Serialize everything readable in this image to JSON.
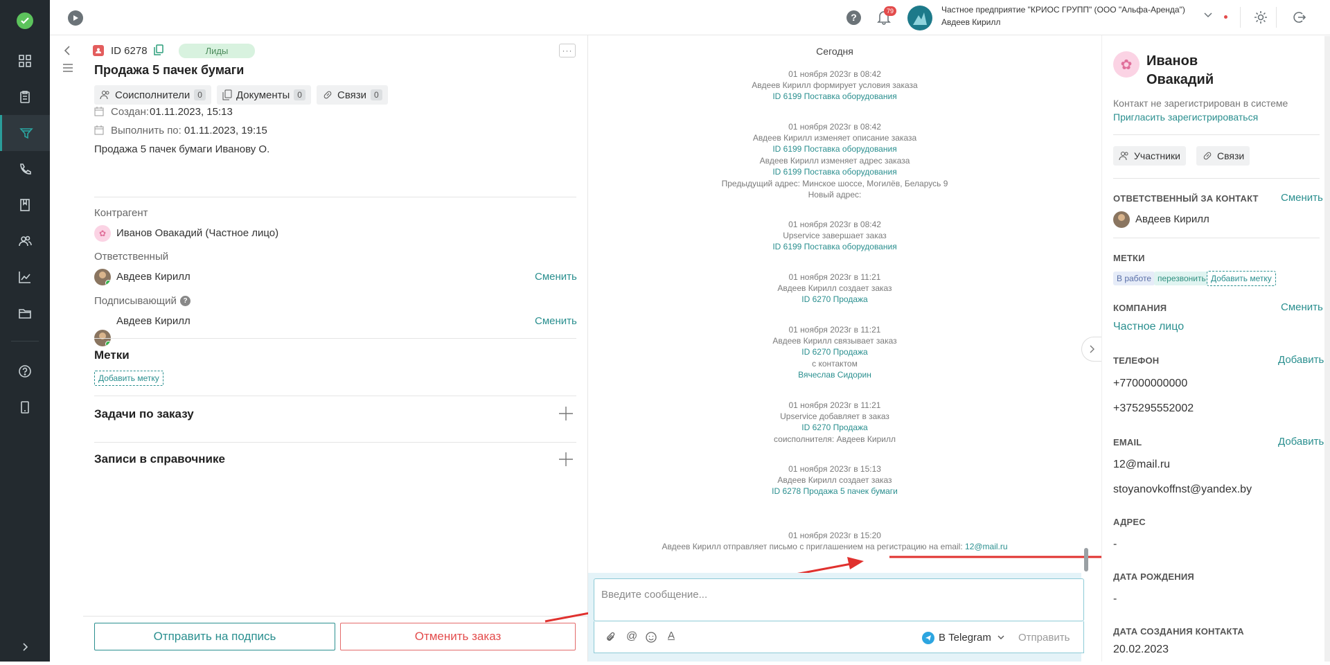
{
  "nav": {
    "items": [
      "dashboard-icon",
      "orders-icon",
      "funnel-icon",
      "calls-icon",
      "book-icon",
      "contacts-icon",
      "analytics-icon",
      "folder-icon",
      "help-icon",
      "mobile-icon"
    ]
  },
  "topbar": {
    "notifications_count": "79",
    "company": "Частное предприятие \"КРИОС ГРУПП\" (ООО \"Альфа-Аренда\")",
    "user": "Авдеев Кирилл"
  },
  "order": {
    "id": "ID 6278",
    "tag": "Лиды",
    "title": "Продажа 5 пачек бумаги",
    "chips": [
      {
        "label": "Соисполнители",
        "count": "0"
      },
      {
        "label": "Документы",
        "count": "0"
      },
      {
        "label": "Связи",
        "count": "0"
      }
    ],
    "created_label": "Создан:",
    "created_value": "01.11.2023, 15:13",
    "due_label": "Выполнить по:",
    "due_value": "01.11.2023, 19:15",
    "description": "Продажа 5 пачек бумаги Иванову О.",
    "counterparty_label": "Контрагент",
    "counterparty_value": "Иванов Овакадий (Частное лицо)",
    "responsible_label": "Ответственный",
    "responsible_value": "Авдеев Кирилл",
    "signer_label": "Подписывающий",
    "signer_value": "Авдеев Кирилл",
    "change": "Сменить",
    "tags_title": "Метки",
    "add_tag": "Добавить метку",
    "tasks_title": "Задачи по заказу",
    "records_title": "Записи в справочнике",
    "send_sign": "Отправить на подпись",
    "cancel_order": "Отменить заказ"
  },
  "feed": {
    "day": "Сегодня",
    "events": [
      {
        "lines": [
          {
            "t": "01 ноября 2023г в 08:42"
          },
          {
            "t": "Авдеев Кирилл формирует условия заказа"
          },
          {
            "t": "ID 6199 Поставка оборудования",
            "link": true
          }
        ]
      },
      {
        "lines": [
          {
            "t": "01 ноября 2023г в 08:42"
          },
          {
            "t": "Авдеев Кирилл изменяет описание заказа"
          },
          {
            "t": "ID 6199 Поставка оборудования",
            "link": true
          },
          {
            "t": "Авдеев Кирилл изменяет адрес заказа"
          },
          {
            "t": "ID 6199 Поставка оборудования",
            "link": true
          },
          {
            "t": "Предыдущий адрес: Минское шоссе, Могилёв, Беларусь 9"
          },
          {
            "t": "Новый адрес:"
          }
        ]
      },
      {
        "lines": [
          {
            "t": "01 ноября 2023г в 08:42"
          },
          {
            "t": "Upservice завершает заказ"
          },
          {
            "t": "ID 6199 Поставка оборудования",
            "link": true
          }
        ]
      },
      {
        "lines": [
          {
            "t": "01 ноября 2023г в 11:21"
          },
          {
            "t": "Авдеев Кирилл создает заказ"
          },
          {
            "t": "ID 6270 Продажа",
            "link": true
          }
        ]
      },
      {
        "lines": [
          {
            "t": "01 ноября 2023г в 11:21"
          },
          {
            "t": "Авдеев Кирилл связывает заказ"
          },
          {
            "t": "ID 6270 Продажа",
            "link": true
          },
          {
            "t": "с контактом"
          },
          {
            "t": "Вячеслав Сидорин",
            "link": true
          }
        ]
      },
      {
        "lines": [
          {
            "t": "01 ноября 2023г в 11:21"
          },
          {
            "t": "Upservice добавляет в заказ"
          },
          {
            "t": "ID 6270 Продажа",
            "link": true
          },
          {
            "t": "соисполнителя: Авдеев Кирилл"
          }
        ]
      },
      {
        "lines": [
          {
            "t": "01 ноября 2023г в 15:13"
          },
          {
            "t": "Авдеев Кирилл создает заказ"
          },
          {
            "t": "ID 6278 Продажа 5 пачек бумаги",
            "link": true
          }
        ]
      }
    ],
    "last_time": "01 ноября 2023г в 15:20",
    "last_text": "Авдеев Кирилл отправляет письмо с приглашением на регистрацию на email:",
    "last_email": "12@mail.ru",
    "composer_placeholder": "Введите сообщение...",
    "channel": "В Telegram",
    "send": "Отправить"
  },
  "contact": {
    "name_line1": "Иванов",
    "name_line2": "Овакадий",
    "not_registered": "Контакт не зарегистрирован в системе",
    "invite": "Пригласить зарегистрироваться",
    "participants": "Участники",
    "links": "Связи",
    "responsible_title": "ОТВЕТСТВЕННЫЙ ЗА КОНТАКТ",
    "change": "Сменить",
    "responsible_value": "Авдеев Кирилл",
    "tags_title": "МЕТКИ",
    "tags": [
      "В работе",
      "перезвонить"
    ],
    "add_tag": "Добавить метку",
    "company_title": "КОМПАНИЯ",
    "company_value": "Частное лицо",
    "phone_title": "ТЕЛЕФОН",
    "add": "Добавить",
    "phones": [
      "+77000000000",
      "+375295552002"
    ],
    "email_title": "EMAIL",
    "emails": [
      "12@mail.ru",
      "stoyanovkoffnst@yandex.by"
    ],
    "address_title": "АДРЕС",
    "address_value": "-",
    "birth_title": "ДАТА РОЖДЕНИЯ",
    "birth_value": "-",
    "created_title": "ДАТА СОЗДАНИЯ КОНТАКТА",
    "created_value": "20.02.2023"
  },
  "colors": {
    "accent": "#2a8f8f",
    "nav_bg": "#232a2f",
    "danger": "#e34c4c",
    "arrow": "#e0312e"
  }
}
